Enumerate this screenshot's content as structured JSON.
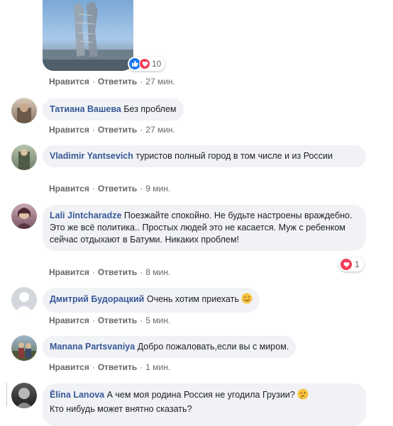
{
  "post": {
    "reactions_count": "10",
    "actions": {
      "like": "Нравится",
      "reply": "Ответить",
      "time": "27 мин."
    }
  },
  "comments": [
    {
      "author": "Татиана Вашева",
      "text": "Без проблем",
      "like": "Нравится",
      "reply": "Ответить",
      "time": "27 мин."
    },
    {
      "author": "Vladimir Yantsevich",
      "text": "туристов полный город в том числе и из России",
      "like": "Нравится",
      "reply": "Ответить",
      "time": "9 мин."
    },
    {
      "author": "Lali Jintcharadze",
      "text": "Поезжайте спокойно. Не будьте настроены враждебно. Это же всё политика.. Простых людей это не касается. Муж с ребенком сейчас отдыхают в Батуми. Никаких проблем!",
      "like": "Нравится",
      "reply": "Ответить",
      "time": "8 мин.",
      "reaction_count": "1"
    },
    {
      "author": "Дмитрий Будорацкий",
      "text": "Очень хотим приехать",
      "like": "Нравится",
      "reply": "Ответить",
      "time": "5 мин."
    },
    {
      "author": "Manana Partsvaniya",
      "text": "Добро пожаловать,если вы с миром.",
      "like": "Нравится",
      "reply": "Ответить",
      "time": "1 мин."
    },
    {
      "author": "Ēlina Lanova",
      "text": "А чем моя родина Россия не угодила Грузии?",
      "text2": "Кто нибудь может внятно сказать?"
    }
  ]
}
